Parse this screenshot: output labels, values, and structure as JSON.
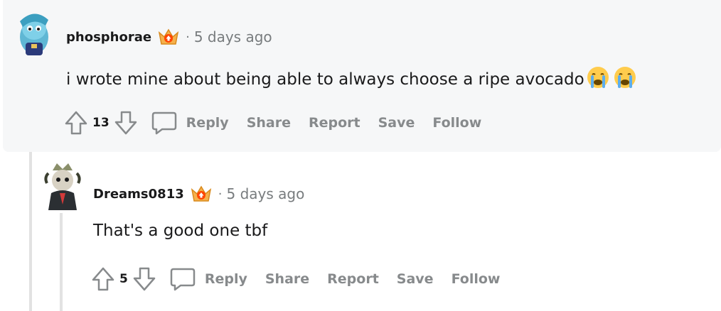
{
  "comments": [
    {
      "username": "phosphorae",
      "separator": "·",
      "time": "5 days ago",
      "text": "i wrote mine about being able to always choose a ripe avocado",
      "emojis": [
        "crying-face",
        "crying-face"
      ],
      "score": "13",
      "actions": {
        "reply": "Reply",
        "share": "Share",
        "report": "Report",
        "save": "Save",
        "follow": "Follow"
      }
    },
    {
      "username": "Dreams0813",
      "separator": "·",
      "time": "5 days ago",
      "text": "That's a good one tbf",
      "score": "5",
      "actions": {
        "reply": "Reply",
        "share": "Share",
        "report": "Report",
        "save": "Save",
        "follow": "Follow"
      }
    }
  ],
  "colors": {
    "comment_bg": "#f6f7f8",
    "meta_gray": "#787c7e",
    "action_gray": "#878a8c",
    "thread_line": "#e2e2e2"
  }
}
